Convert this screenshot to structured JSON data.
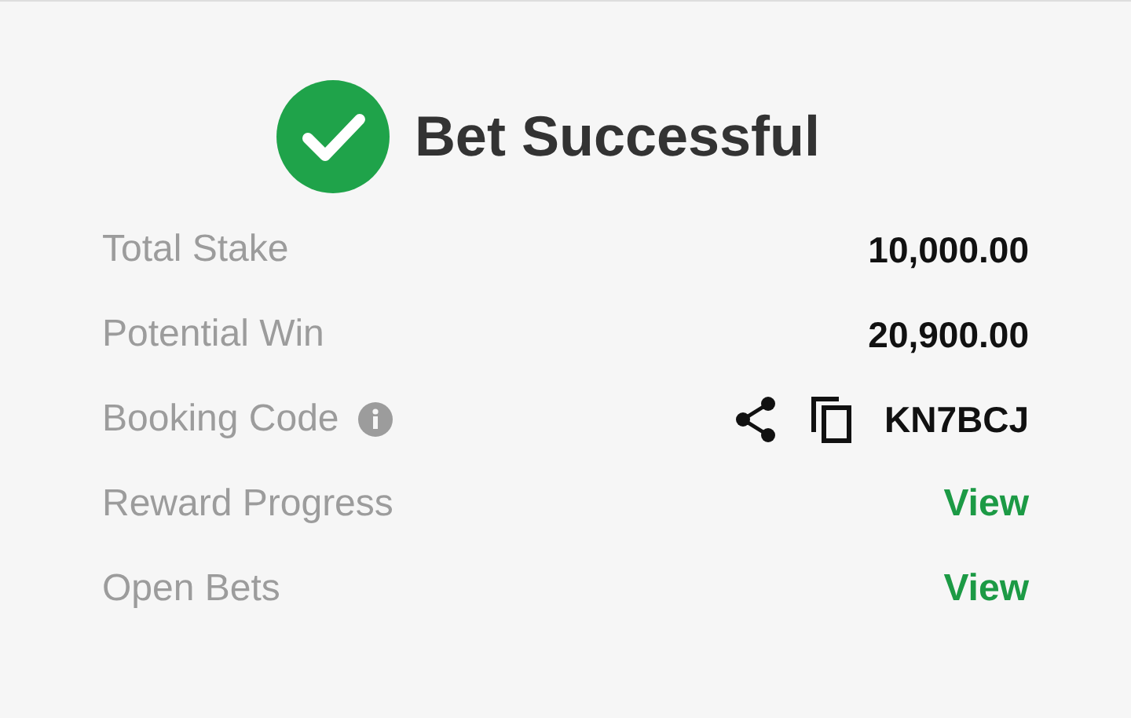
{
  "title": "Bet Successful",
  "rows": [
    {
      "label": "Total Stake",
      "kind": "amount",
      "value": "10,000.00"
    },
    {
      "label": "Potential Win",
      "kind": "amount",
      "value": "20,900.00"
    },
    {
      "label": "Booking Code",
      "kind": "code",
      "value": "KN7BCJ"
    },
    {
      "label": "Reward Progress",
      "kind": "link",
      "value": "View"
    },
    {
      "label": "Open Bets",
      "kind": "link",
      "value": "View"
    }
  ]
}
